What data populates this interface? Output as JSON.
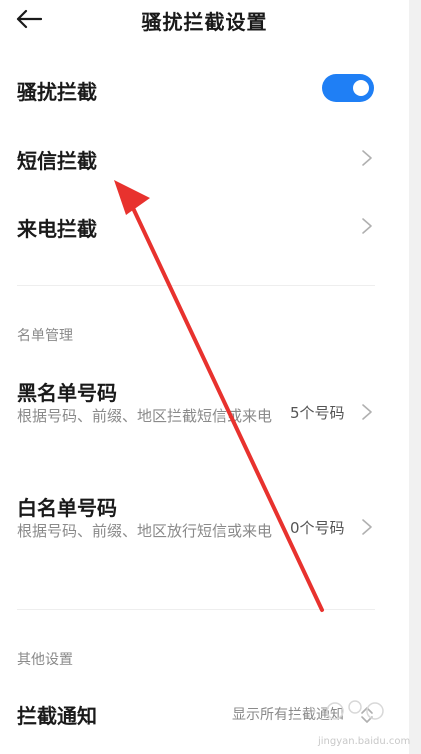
{
  "header": {
    "title": "骚扰拦截设置",
    "back_icon": "arrow-left-icon"
  },
  "settings": {
    "harass_intercept": {
      "label": "骚扰拦截",
      "enabled": true,
      "toggle_color": "#1f7ff5"
    },
    "sms_intercept": {
      "label": "短信拦截"
    },
    "call_intercept": {
      "label": "来电拦截"
    }
  },
  "list_management": {
    "section_title": "名单管理",
    "blacklist": {
      "label": "黑名单号码",
      "description": "根据号码、前缀、地区拦截短信或来电",
      "count": "5个号码"
    },
    "whitelist": {
      "label": "白名单号码",
      "description": "根据号码、前缀、地区放行短信或来电",
      "count": "0个号码"
    }
  },
  "other_settings": {
    "section_title": "其他设置",
    "intercept_notify": {
      "label": "拦截通知",
      "value": "显示所有拦截通知"
    }
  },
  "annotation": {
    "arrow_color": "#e8322e"
  },
  "watermark": {
    "text": "jingyan.baidu.com"
  }
}
